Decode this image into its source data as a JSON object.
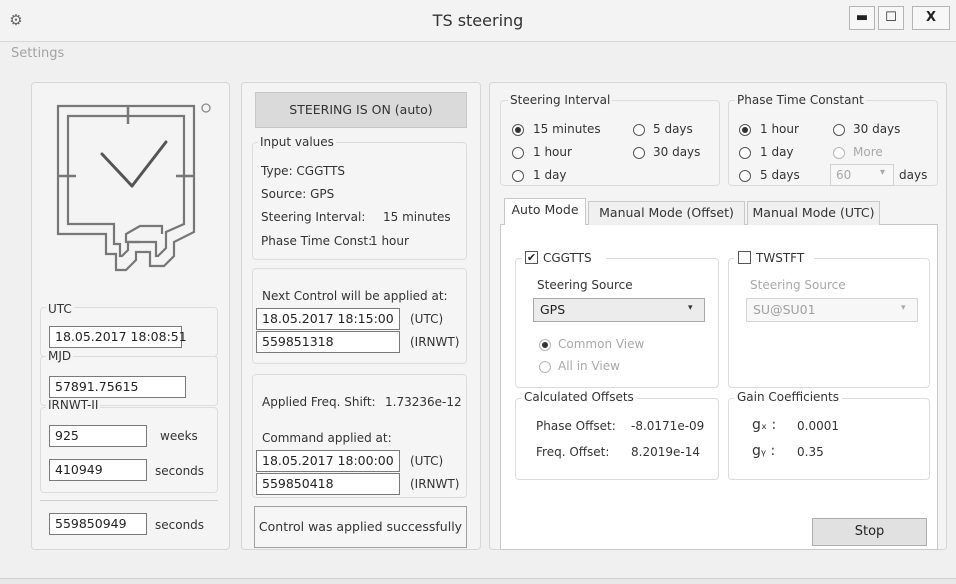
{
  "window": {
    "title": "TS steering",
    "minimize_glyph": "▬",
    "maximize_glyph": "☐",
    "close_glyph": "X",
    "app_icon": "⚙"
  },
  "menu": {
    "settings": "Settings"
  },
  "clock": {
    "utc_label": "UTC",
    "utc_value": "18.05.2017 18:08:51",
    "mjd_label": "MJD",
    "mjd_value": "57891.75615",
    "irnwt_label": "IRNWT-II",
    "weeks_value": "925",
    "weeks_unit": "weeks",
    "seconds_value": "410949",
    "seconds_unit": "seconds",
    "total_value": "559850949",
    "total_unit": "seconds"
  },
  "status": {
    "steering_state": "STEERING IS ON (auto)",
    "input_title": "Input values",
    "type_line": "Type: CGGTTS",
    "source_line": "Source: GPS",
    "interval_label": "Steering Interval:",
    "interval_value": "15 minutes",
    "ptc_label": "Phase Time Const:",
    "ptc_value": "1 hour",
    "next_title": "Next Control will be applied at:",
    "next_utc": "18.05.2017 18:15:00",
    "next_utc_unit": "(UTC)",
    "next_irnwt": "559851318",
    "next_irnwt_unit": "(IRNWT)",
    "freq_shift_label": "Applied Freq. Shift:",
    "freq_shift_value": "1.73236e-12",
    "cmd_title": "Command applied at:",
    "cmd_utc": "18.05.2017 18:00:00",
    "cmd_utc_unit": "(UTC)",
    "cmd_irnwt": "559850418",
    "cmd_irnwt_unit": "(IRNWT)",
    "result": "Control was applied successfully"
  },
  "steering_interval": {
    "title": "Steering Interval",
    "options": [
      "15 minutes",
      "5 days",
      "1 hour",
      "30 days",
      "1 day"
    ],
    "selected": "15 minutes"
  },
  "phase_time_constant": {
    "title": "Phase Time Constant",
    "options": [
      "1 hour",
      "30 days",
      "1 day",
      "More",
      "5 days"
    ],
    "selected": "1 hour",
    "days_value": "60",
    "days_label": "days"
  },
  "tabs": [
    "Auto Mode",
    "Manual Mode (Offset)",
    "Manual Mode (UTC)"
  ],
  "active_tab": "Auto Mode",
  "cggtts": {
    "label": "CGGTTS",
    "checked": true,
    "source_label": "Steering Source",
    "source_value": "GPS",
    "common_view": "Common View",
    "all_in_view": "All in View"
  },
  "twstft": {
    "label": "TWSTFT",
    "checked": false,
    "source_label": "Steering Source",
    "source_value": "SU@SU01"
  },
  "offsets": {
    "title": "Calculated Offsets",
    "phase_label": "Phase Offset:",
    "phase_value": "-8.0171e-09",
    "freq_label": "Freq. Offset:",
    "freq_value": "8.2019e-14"
  },
  "gains": {
    "title": "Gain Coefficients",
    "gx_label": "gₓ :",
    "gx_value": "0.0001",
    "gy_label": "gᵧ :",
    "gy_value": "0.35"
  },
  "stop_label": "Stop",
  "dropdown_arrow": "▾",
  "check_mark": "✔"
}
